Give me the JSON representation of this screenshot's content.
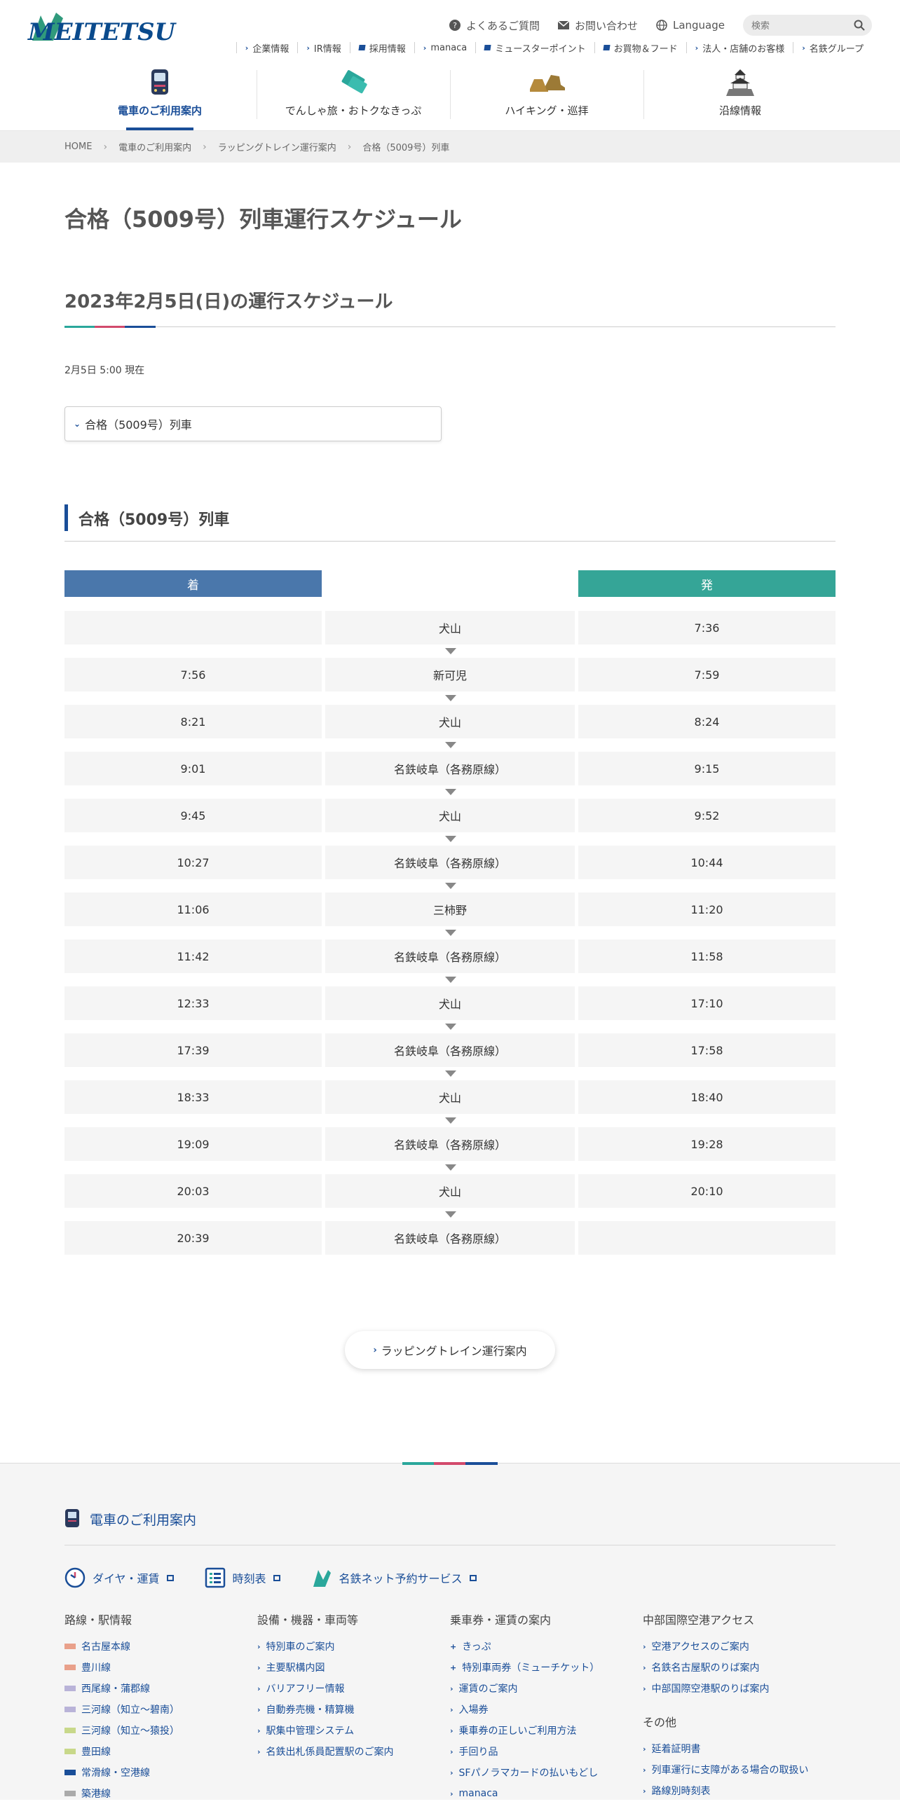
{
  "brand": {
    "logo_text": "MEITETSU",
    "primary_color": "#1a4e98",
    "arrival_color": "#4a77ab",
    "departure_color": "#35a597"
  },
  "header": {
    "util": {
      "faq": "よくあるご質問",
      "contact": "お問い合わせ",
      "language": "Language",
      "search_placeholder": "検索"
    },
    "subnav": [
      "企業情報",
      "IR情報",
      "採用情報",
      "manaca",
      "ミュースターポイント",
      "お買物＆フード",
      "法人・店舗のお客様",
      "名鉄グループ"
    ],
    "gnav": [
      "電車のご利用案内",
      "でんしゃ旅・おトクなきっぷ",
      "ハイキング・巡拝",
      "沿線情報"
    ]
  },
  "breadcrumb": [
    "HOME",
    "電車のご利用案内",
    "ラッピングトレイン運行案内",
    "合格（5009号）列車"
  ],
  "main": {
    "page_title": "合格（5009号）列車運行スケジュール",
    "schedule_heading": "2023年2月5日(日)の運行スケジュール",
    "as_of": "2月5日 5:00 現在",
    "toc_item": "合格（5009号）列車",
    "train_heading": "合格（5009号）列車",
    "col_arrival": "着",
    "col_departure": "発",
    "timetable": [
      {
        "arr": "",
        "station": "犬山",
        "dep": "7:36"
      },
      {
        "arr": "7:56",
        "station": "新可児",
        "dep": "7:59"
      },
      {
        "arr": "8:21",
        "station": "犬山",
        "dep": "8:24"
      },
      {
        "arr": "9:01",
        "station": "名鉄岐阜（各務原線）",
        "dep": "9:15"
      },
      {
        "arr": "9:45",
        "station": "犬山",
        "dep": "9:52"
      },
      {
        "arr": "10:27",
        "station": "名鉄岐阜（各務原線）",
        "dep": "10:44"
      },
      {
        "arr": "11:06",
        "station": "三柿野",
        "dep": "11:20"
      },
      {
        "arr": "11:42",
        "station": "名鉄岐阜（各務原線）",
        "dep": "11:58"
      },
      {
        "arr": "12:33",
        "station": "犬山",
        "dep": "17:10"
      },
      {
        "arr": "17:39",
        "station": "名鉄岐阜（各務原線）",
        "dep": "17:58"
      },
      {
        "arr": "18:33",
        "station": "犬山",
        "dep": "18:40"
      },
      {
        "arr": "19:09",
        "station": "名鉄岐阜（各務原線）",
        "dep": "19:28"
      },
      {
        "arr": "20:03",
        "station": "犬山",
        "dep": "20:10"
      },
      {
        "arr": "20:39",
        "station": "名鉄岐阜（各務原線）",
        "dep": ""
      }
    ],
    "back_button": "ラッピングトレイン運行案内"
  },
  "footer": {
    "section_title": "電車のご利用案内",
    "top_links": [
      "ダイヤ・運賃",
      "時刻表",
      "名鉄ネット予約サービス"
    ],
    "columns": [
      {
        "title": "路線・駅情報",
        "items": [
          {
            "label": "名古屋本線",
            "color": "#e9a08a"
          },
          {
            "label": "豊川線",
            "color": "#e9a08a"
          },
          {
            "label": "西尾線・蒲郡線",
            "color": "#b9b3d8"
          },
          {
            "label": "三河線（知立〜碧南）",
            "color": "#b9b3d8"
          },
          {
            "label": "三河線（知立〜猿投）",
            "color": "#c8d88a"
          },
          {
            "label": "豊田線",
            "color": "#c8d88a"
          },
          {
            "label": "常滑線・空港線",
            "color": "#1a4e98"
          },
          {
            "label": "築港線",
            "color": "#aaaaaa"
          }
        ]
      },
      {
        "title": "設備・機器・車両等",
        "items": [
          "特別車のご案内",
          "主要駅構内図",
          "バリアフリー情報",
          "自動券売機・精算機",
          "駅集中管理システム",
          "名鉄出札係員配置駅のご案内"
        ]
      },
      {
        "title": "乗車券・運賃の案内",
        "items": [
          "きっぷ",
          "特別車両券（ミューチケット）",
          "運賃のご案内",
          "入場券",
          "乗車券の正しいご利用方法",
          "手回り品",
          "SFパノラマカードの払いもどし",
          "manaca"
        ]
      },
      {
        "title": "中部国際空港アクセス",
        "items": [
          "空港アクセスのご案内",
          "名鉄名古屋駅のりば案内",
          "中部国際空港駅のりば案内"
        ],
        "title2": "その他",
        "items2": [
          "延着証明書",
          "列車運行に支障がある場合の取扱い",
          "路線別時刻表"
        ]
      }
    ]
  }
}
